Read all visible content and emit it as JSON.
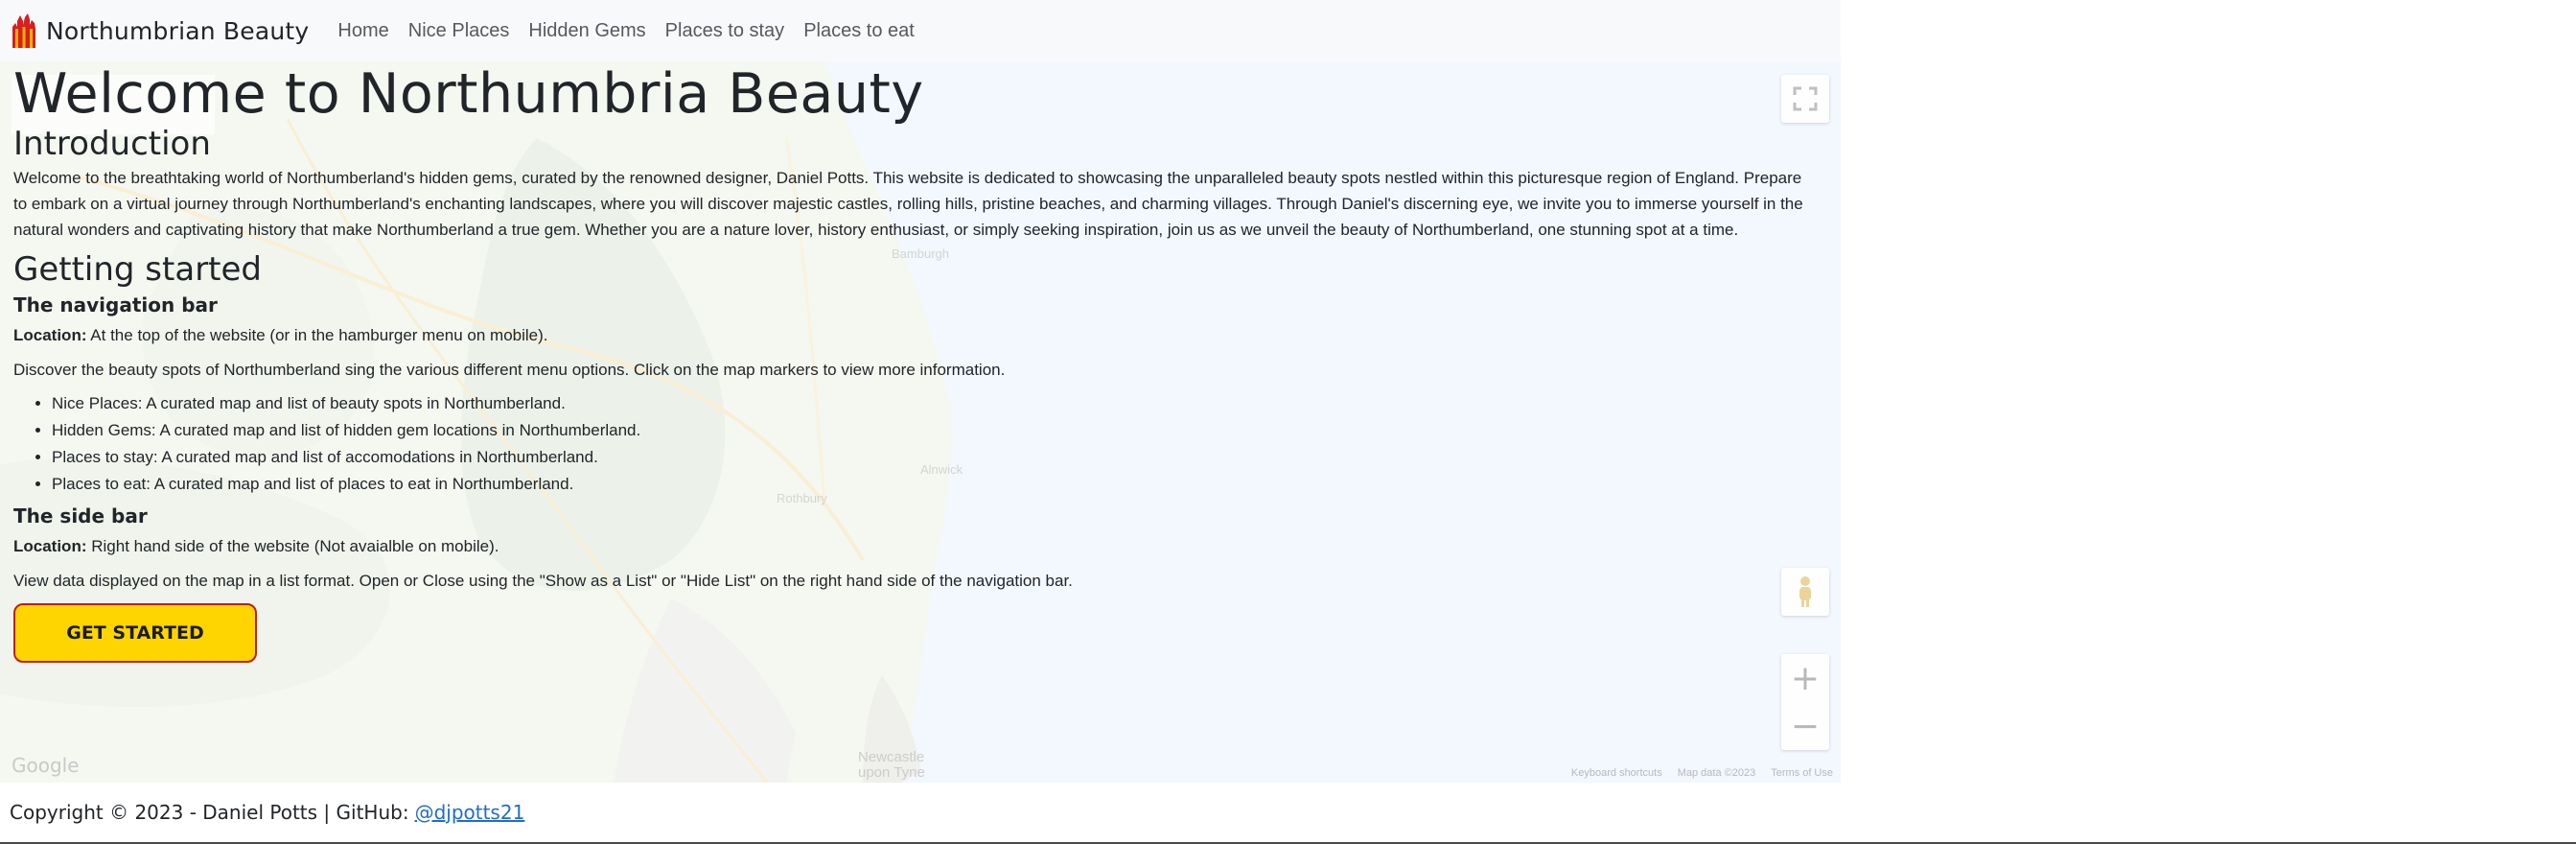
{
  "navbar": {
    "brand": "Northumbrian Beauty",
    "links": [
      "Home",
      "Nice Places",
      "Hidden Gems",
      "Places to stay",
      "Places to eat"
    ]
  },
  "map": {
    "footer": [
      "Keyboard shortcuts",
      "Map data ©2023",
      "Terms of Use"
    ],
    "google": "Google",
    "places": [
      "Newcastle upon Tyne",
      "Bamburgh",
      "Rothbury",
      "Alnwick"
    ]
  },
  "content": {
    "title": "Welcome to Northumbria Beauty",
    "intro_heading": "Introduction",
    "intro_text": "Welcome to the breathtaking world of Northumberland's hidden gems, curated by the renowned designer, Daniel Potts. This website is dedicated to showcasing the unparalleled beauty spots nestled within this picturesque region of England. Prepare to embark on a virtual journey through Northumberland's enchanting landscapes, where you will discover majestic castles, rolling hills, pristine beaches, and charming villages. Through Daniel's discerning eye, we invite you to immerse yourself in the natural wonders and captivating history that make Northumberland a true gem. Whether you are a nature lover, history enthusiast, or simply seeking inspiration, join us as we unveil the beauty of Northumberland, one stunning spot at a time.",
    "getting_started_heading": "Getting started",
    "navbar_section": {
      "heading": "The navigation bar",
      "location_label": "Location:",
      "location_text": "At the top of the website (or in the hamburger menu on mobile).",
      "description": "Discover the beauty spots of Northumberland sing the various different menu options. Click on the map markers to view more information.",
      "items": [
        "Nice Places: A curated map and list of beauty spots in Northumberland.",
        "Hidden Gems: A curated map and list of hidden gem locations in Northumberland.",
        "Places to stay: A curated map and list of accomodations in Northumberland.",
        "Places to eat: A curated map and list of places to eat in Northumberland."
      ]
    },
    "sidebar_section": {
      "heading": "The side bar",
      "location_label": "Location:",
      "location_text": "Right hand side of the website (Not avaialble on mobile).",
      "description": "View data displayed on the map in a list format. Open or Close using the \"Show as a List\" or \"Hide List\" on the right hand side of the navigation bar."
    },
    "cta": "GET STARTED"
  },
  "footer": {
    "text": "Copyright © 2023 - Daniel Potts | GitHub:",
    "link": "@djpotts21"
  },
  "colors": {
    "navbar_bg": "#f8f9fa",
    "sea": "#e4eefc",
    "button": "#ffd500",
    "button_border": "#c21d1d",
    "link": "#1f6bd1"
  }
}
